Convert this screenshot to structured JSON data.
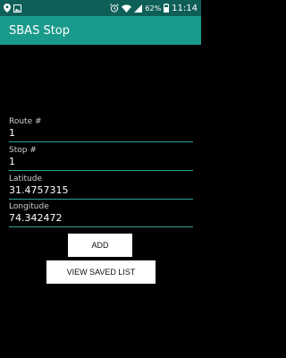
{
  "status_bar": {
    "battery_percent": "62%",
    "time": "11:14",
    "icons": [
      "location-icon",
      "image-icon",
      "alarm-icon",
      "wifi-icon",
      "signal-icon",
      "battery-icon"
    ]
  },
  "app_bar": {
    "title": "SBAS Stop"
  },
  "form": {
    "route": {
      "label": "Route #",
      "value": "1"
    },
    "stop": {
      "label": "Stop #",
      "value": "1"
    },
    "latitude": {
      "label": "Latitude",
      "value": "31.4757315"
    },
    "longitude": {
      "label": "Longitude",
      "value": "74.342472"
    }
  },
  "buttons": {
    "add_label": "ADD",
    "view_saved_label": "VIEW SAVED LIST"
  },
  "colors": {
    "status_bar_bg": "#0e5f57",
    "app_bar_bg": "#1a9a8a",
    "underline": "#33b5a5",
    "background": "#000000"
  }
}
